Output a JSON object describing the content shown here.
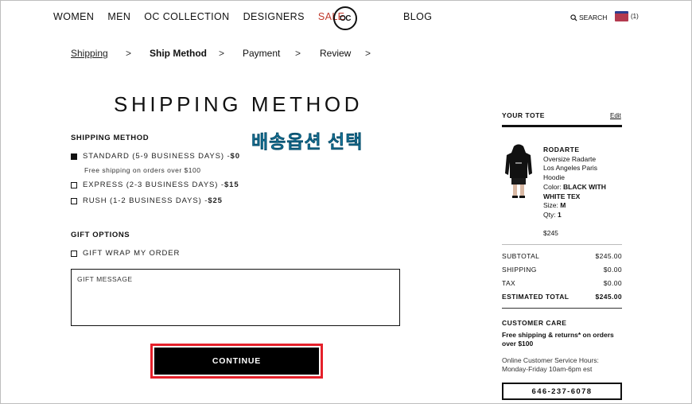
{
  "header": {
    "nav": [
      "WOMEN",
      "MEN",
      "OC COLLECTION",
      "DESIGNERS",
      "SALE"
    ],
    "logo_text": "OC",
    "blog": "BLOG",
    "search_label": "SEARCH",
    "cart_count": "(1)",
    "sale_color": "#c0392b"
  },
  "breadcrumb": {
    "shipping": "Shipping",
    "ship_method": "Ship Method",
    "payment": "Payment",
    "review": "Review",
    "separator": ">"
  },
  "page_title": "SHIPPING METHOD",
  "annotation_korean": "배송옵션 선택",
  "shipping": {
    "label": "SHIPPING METHOD",
    "options": [
      {
        "text": "STANDARD (5-9 BUSINESS DAYS) - ",
        "price": "$0",
        "selected": true
      },
      {
        "text": "EXPRESS (2-3 BUSINESS DAYS) - ",
        "price": "$15",
        "selected": false
      },
      {
        "text": "RUSH (1-2 BUSINESS DAYS) - ",
        "price": "$25",
        "selected": false
      }
    ],
    "free_note": "Free shipping on orders over $100"
  },
  "gift": {
    "label": "GIFT OPTIONS",
    "wrap_label": "GIFT WRAP MY ORDER",
    "message_placeholder": "GIFT MESSAGE"
  },
  "continue_label": "CONTINUE",
  "highlight_color": "#e5202a",
  "tote": {
    "title": "YOUR TOTE",
    "edit": "Edit",
    "item": {
      "brand": "RODARTE",
      "name_line1": "Oversize Radarte",
      "name_line2": "Los Angeles Paris",
      "name_line3": "Hoodie",
      "color_label": "Color: ",
      "color_value_1": "BLACK WITH",
      "color_value_2": "WHITE TEX",
      "size_label": "Size: ",
      "size_value": "M",
      "qty_label": "Qty: ",
      "qty_value": "1",
      "price": "$245"
    },
    "summary": [
      {
        "label": "SUBTOTAL",
        "value": "$245.00"
      },
      {
        "label": "SHIPPING",
        "value": "$0.00"
      },
      {
        "label": "TAX",
        "value": "$0.00"
      },
      {
        "label": "ESTIMATED TOTAL",
        "value": "$245.00"
      }
    ]
  },
  "care": {
    "title": "CUSTOMER CARE",
    "free_line": "Free shipping & returns* on orders over $100",
    "hours_line1": "Online Customer Service Hours:",
    "hours_line2": "Monday-Friday 10am-6pm est",
    "phone": "646-237-6078"
  }
}
